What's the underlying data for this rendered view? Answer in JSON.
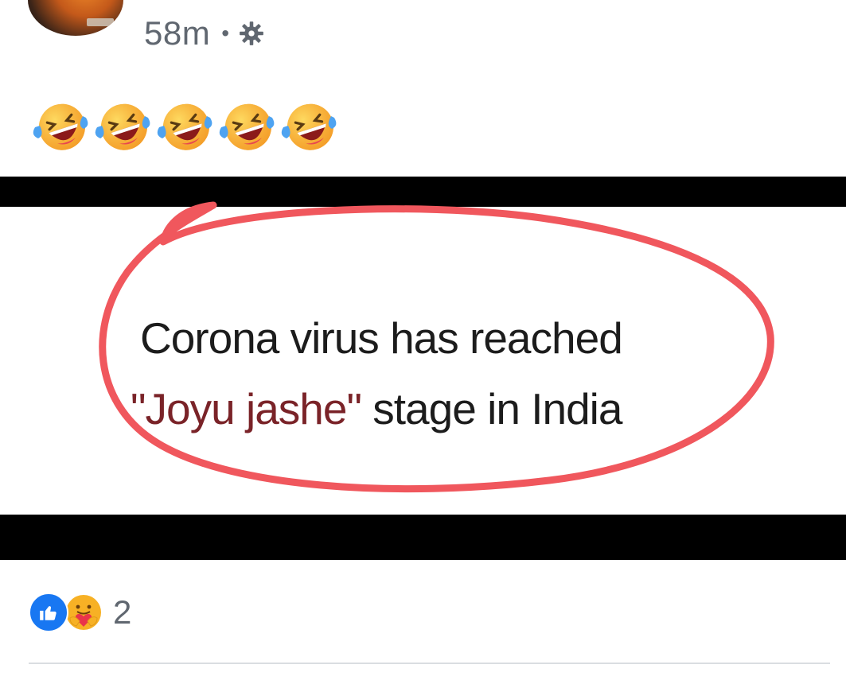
{
  "post": {
    "timestamp": "58m",
    "separator": "•",
    "privacy_icon": "gear-icon",
    "emoji_text": [
      "laughing-crying-emoji",
      "laughing-crying-emoji",
      "laughing-crying-emoji",
      "laughing-crying-emoji",
      "laughing-crying-emoji"
    ],
    "image": {
      "line1": "Corona virus has reached",
      "line2_highlight": "\"Joyu jashe\"",
      "line2_rest": " stage in India",
      "circle_color": "#f0575d"
    }
  },
  "reactions": {
    "icons": [
      "like-icon",
      "care-icon"
    ],
    "count": "2",
    "like_color": "#1877f2"
  }
}
